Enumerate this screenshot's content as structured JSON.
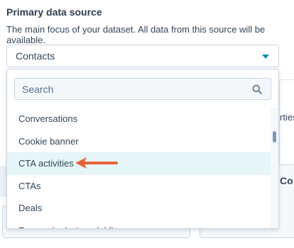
{
  "section": {
    "title": "Primary data source",
    "description": "The main focus of your dataset. All data from this source will be available."
  },
  "select": {
    "value": "Contacts"
  },
  "dropdown": {
    "search_placeholder": "Search",
    "items": [
      {
        "label": "Conversations"
      },
      {
        "label": "Cookie banner"
      },
      {
        "label": "CTA activities"
      },
      {
        "label": "CTAs"
      },
      {
        "label": "Deals"
      },
      {
        "label": "Form submissions (old)"
      }
    ],
    "highlighted_index": 2
  },
  "background": {
    "right_text": "rties",
    "right_heading": "Co"
  },
  "colors": {
    "accent": "#0091ae",
    "highlight": "#e5f5f8",
    "arrow": "#e8613c"
  }
}
